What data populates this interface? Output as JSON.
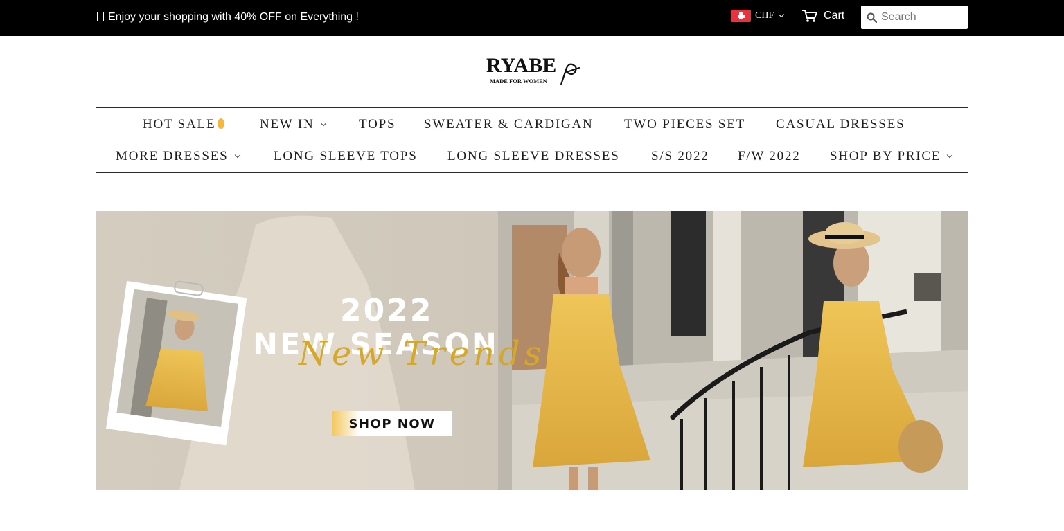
{
  "announcement": {
    "text": "Enjoy your shopping with 40% OFF on Everything !",
    "icon": "missing-glyph-box"
  },
  "currency": {
    "code": "CHF",
    "flag": "switzerland-flag"
  },
  "cart": {
    "label": "Cart"
  },
  "search": {
    "placeholder": "Search"
  },
  "logo": {
    "name": "RYABE",
    "tagline": "MADE FOR WOMEN"
  },
  "nav": {
    "row1": [
      {
        "label": "HOT SALE",
        "has_dropdown": false,
        "icon": "flame-emoji"
      },
      {
        "label": "NEW IN",
        "has_dropdown": true
      },
      {
        "label": "TOPS",
        "has_dropdown": false
      },
      {
        "label": "SWEATER & CARDIGAN",
        "has_dropdown": false
      },
      {
        "label": "TWO PIECES SET",
        "has_dropdown": false
      },
      {
        "label": "CASUAL DRESSES",
        "has_dropdown": false
      }
    ],
    "row2": [
      {
        "label": "MORE DRESSES",
        "has_dropdown": true
      },
      {
        "label": "LONG SLEEVE TOPS",
        "has_dropdown": false
      },
      {
        "label": "LONG SLEEVE DRESSES",
        "has_dropdown": false
      },
      {
        "label": "S/S 2022",
        "has_dropdown": false
      },
      {
        "label": "F/W 2022",
        "has_dropdown": false
      },
      {
        "label": "SHOP BY PRICE",
        "has_dropdown": true
      }
    ]
  },
  "hero": {
    "year": "2022",
    "title": "NEW SEASON",
    "script": "New Trends",
    "cta": "SHOP NOW"
  },
  "colors": {
    "topbar_bg": "#000000",
    "dress_yellow": "#e8b84a",
    "script_gold": "#d5a72a",
    "flag_red": "#e4343f"
  }
}
